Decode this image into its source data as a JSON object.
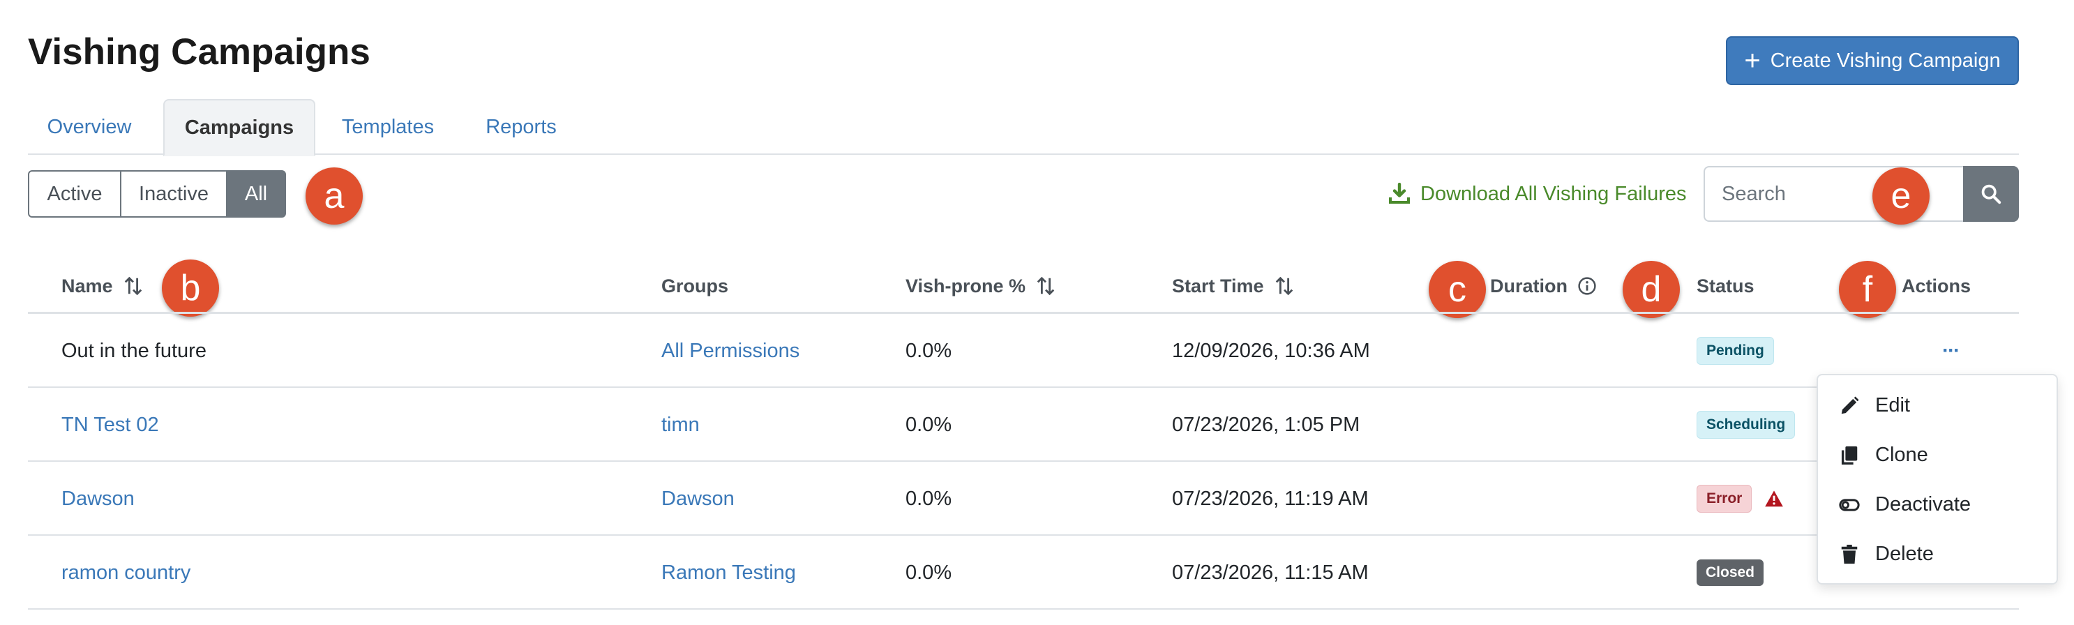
{
  "page": {
    "title": "Vishing Campaigns",
    "create_button": "Create Vishing Campaign"
  },
  "tabs": [
    {
      "label": "Overview",
      "active": false
    },
    {
      "label": "Campaigns",
      "active": true
    },
    {
      "label": "Templates",
      "active": false
    },
    {
      "label": "Reports",
      "active": false
    }
  ],
  "filters": [
    {
      "label": "Active",
      "active": false
    },
    {
      "label": "Inactive",
      "active": false
    },
    {
      "label": "All",
      "active": true
    }
  ],
  "download_link": "Download All Vishing Failures",
  "search": {
    "placeholder": "Search",
    "value": ""
  },
  "annotations": [
    "a",
    "b",
    "c",
    "d",
    "e",
    "f"
  ],
  "table": {
    "columns": {
      "name": "Name",
      "groups": "Groups",
      "vish_prone": "Vish-prone %",
      "start_time": "Start Time",
      "duration": "Duration",
      "status": "Status",
      "actions": "Actions"
    },
    "rows": [
      {
        "name": "Out in the future",
        "groups": "All Permissions",
        "vish_prone": "0.0%",
        "start_time": "12/09/2026, 10:36 AM",
        "status": "Pending",
        "actions": "···"
      },
      {
        "name": "TN Test 02",
        "groups": "timn",
        "vish_prone": "0.0%",
        "start_time": "07/23/2026, 1:05 PM",
        "status": "Scheduling"
      },
      {
        "name": "Dawson",
        "groups": "Dawson",
        "vish_prone": "0.0%",
        "start_time": "07/23/2026, 11:19 AM",
        "status": "Error"
      },
      {
        "name": "ramon country",
        "groups": "Ramon Testing",
        "vish_prone": "0.0%",
        "start_time": "07/23/2026, 11:15 AM",
        "status": "Closed"
      }
    ]
  },
  "actions_menu": {
    "edit": "Edit",
    "clone": "Clone",
    "deactivate": "Deactivate",
    "delete": "Delete"
  },
  "colors": {
    "primary": "#3f7bbd",
    "link": "#3a78b8",
    "download_green": "#4a8a2b",
    "annotation": "#e0502e",
    "error_icon": "#b3161f"
  }
}
